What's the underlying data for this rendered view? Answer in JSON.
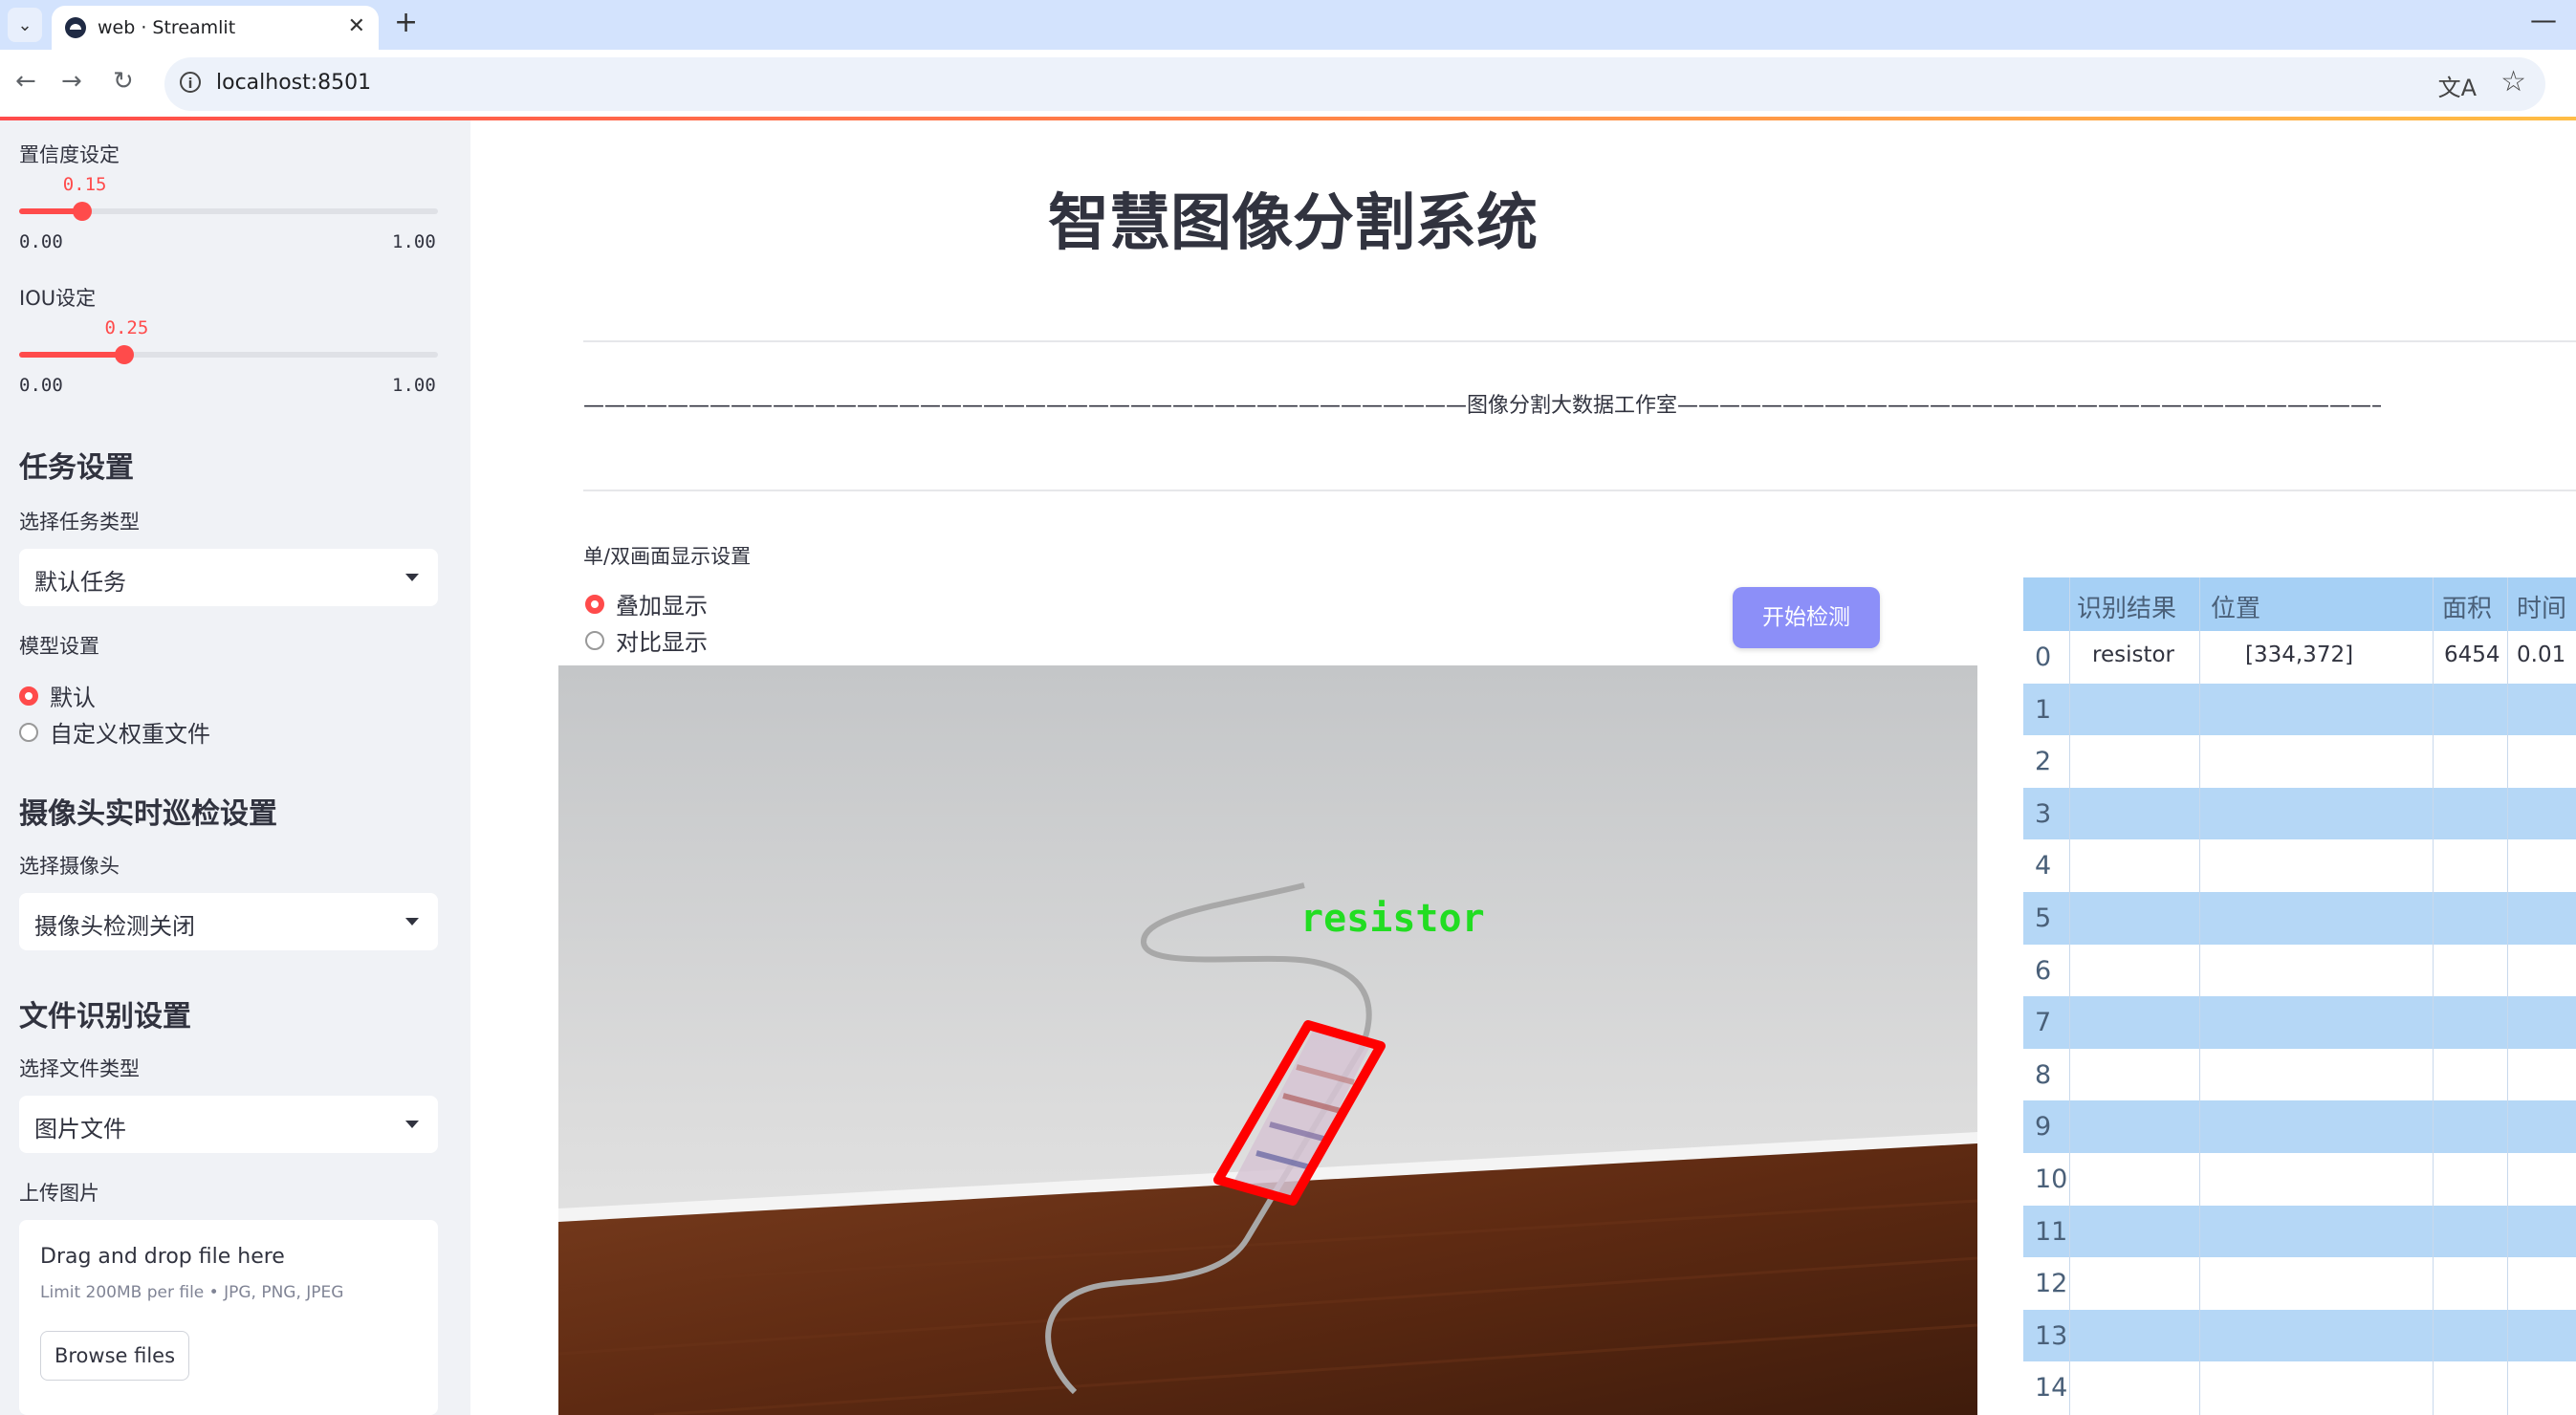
{
  "browser": {
    "tab_title": "web · Streamlit",
    "new_tab_symbol": "+",
    "close_symbol": "✕",
    "url": "localhost:8501",
    "minimize_symbol": "—"
  },
  "sidebar": {
    "confidence": {
      "label": "置信度设定",
      "value": "0.15",
      "min": "0.00",
      "max": "1.00",
      "fraction": 0.15
    },
    "iou": {
      "label": "IOU设定",
      "value": "0.25",
      "min": "0.00",
      "max": "1.00",
      "fraction": 0.25
    },
    "task_header": "任务设置",
    "task_type_label": "选择任务类型",
    "task_type_value": "默认任务",
    "model_label": "模型设置",
    "model_options": [
      "默认",
      "自定义权重文件"
    ],
    "model_selected": 0,
    "camera_header": "摄像头实时巡检设置",
    "camera_label": "选择摄像头",
    "camera_value": "摄像头检测关闭",
    "file_header": "文件识别设置",
    "file_type_label": "选择文件类型",
    "file_type_value": "图片文件",
    "upload_label": "上传图片",
    "uploader": {
      "title": "Drag and drop file here",
      "limit": "Limit 200MB per file • JPG, PNG, JPEG",
      "button": "Browse files"
    }
  },
  "main": {
    "title": "智慧图像分割系统",
    "divider_text": "——————————————————————————————————————————图像分割大数据工作室——————————————————————————————————————————",
    "display_mode_label": "单/双画面显示设置",
    "display_modes": [
      "叠加显示",
      "对比显示"
    ],
    "display_selected": 0,
    "start_button": "开始检测",
    "detection_label": "resistor"
  },
  "results_table": {
    "columns": [
      "识别结果",
      "位置",
      "面积",
      "时间"
    ],
    "rows": [
      {
        "index": "0",
        "result": "resistor",
        "position": "[334,372]",
        "area": "6454",
        "time": "0.01"
      },
      {
        "index": "1"
      },
      {
        "index": "2"
      },
      {
        "index": "3"
      },
      {
        "index": "4"
      },
      {
        "index": "5"
      },
      {
        "index": "6"
      },
      {
        "index": "7"
      },
      {
        "index": "8"
      },
      {
        "index": "9"
      },
      {
        "index": "10"
      },
      {
        "index": "11"
      },
      {
        "index": "12"
      },
      {
        "index": "13"
      },
      {
        "index": "14"
      }
    ]
  },
  "colors": {
    "accent": "#ff4b4b",
    "sidebar_bg": "#f0f2f6",
    "button_bg": "#8c8ff8",
    "table_header": "#a6d0f5",
    "table_stripe": "#b5d7f6",
    "detection_box": "#ff0000",
    "detection_text": "#22dd22"
  },
  "icons": {
    "tab_menu": "chevron-down-icon",
    "back": "arrow-left-icon",
    "forward": "arrow-right-icon",
    "reload": "reload-icon",
    "site_info": "info-icon",
    "translate": "translate-icon",
    "bookmark": "star-icon"
  }
}
